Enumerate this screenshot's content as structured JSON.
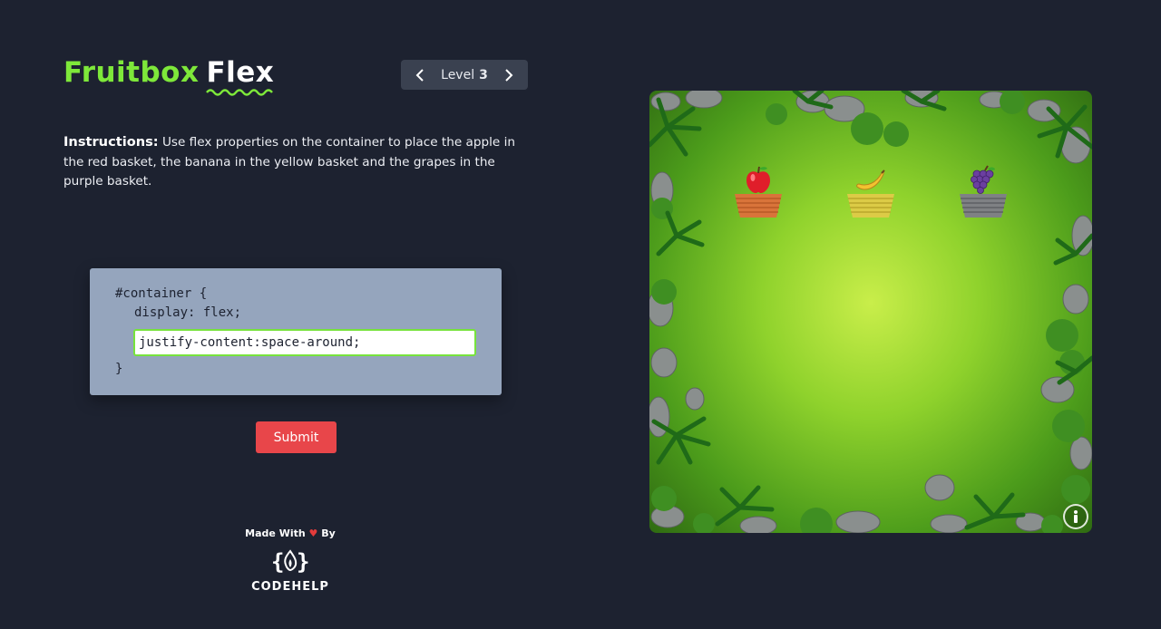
{
  "brand": {
    "part1": "Fruitbox",
    "part2": "Flex"
  },
  "level": {
    "label": "Level",
    "number": "3"
  },
  "instructions": {
    "title": "Instructions:",
    "text": "Use flex properties on the container to place the apple in the red basket, the banana in the yellow basket and the grapes in the purple basket."
  },
  "editor": {
    "line1": "#container {",
    "line2": "display: flex;",
    "input_value": "justify-content:space-around;",
    "closing": "}"
  },
  "submit_label": "Submit",
  "footer": {
    "made_with": "Made With",
    "by": "By",
    "name": "CODEHELP"
  },
  "colors": {
    "accent": "#7ee83a",
    "submit": "#e8464a",
    "background": "#1d2230",
    "editor_bg": "#95a5bd"
  },
  "game": {
    "fruits": [
      "apple",
      "banana",
      "grapes"
    ],
    "baskets": [
      "red",
      "yellow",
      "purple"
    ]
  }
}
